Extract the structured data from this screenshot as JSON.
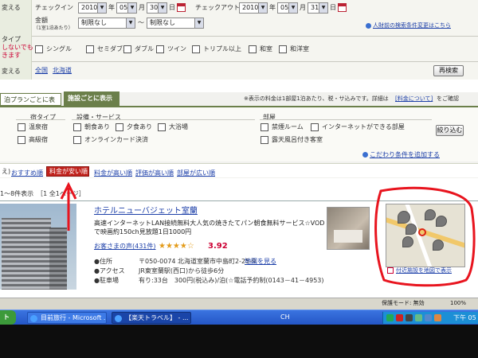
{
  "form": {
    "checkin_label": "チェックイン",
    "checkin": {
      "year": "2010",
      "year_unit": "年",
      "month": "05",
      "month_unit": "月",
      "day": "30",
      "day_unit": "日"
    },
    "checkout_label": "チェックアウト",
    "checkout": {
      "year": "2010",
      "year_unit": "年",
      "month": "05",
      "month_unit": "月",
      "day": "31",
      "day_unit": "日"
    },
    "price_label": "金額",
    "price_sublabel": "（1室1泊あたり）",
    "price_min": "制限なし",
    "tilde": "〜",
    "price_max": "制限なし",
    "left_label_1": "変える",
    "left_label_2": "タイプ",
    "left_label_3": "しないでも",
    "left_label_4": "きます",
    "left_label_5": "変える",
    "room_types": [
      "シングル",
      "セミダブル",
      "ダブル",
      "ツイン",
      "トリプル以上",
      "和室",
      "和洋室"
    ],
    "area_all": "全国",
    "area_region": "北海道",
    "research_button": "再検索",
    "history_link": "人財前の検索条件変更はこちら"
  },
  "tabs": {
    "plan": "泊プランごとに表示",
    "facility": "施設ごとに表示"
  },
  "note": {
    "text": "※表示の料金は1部屋1泊あたり、税・サ込みです。詳細は",
    "link": "[料金について]",
    "tail": "をご確認"
  },
  "filters": {
    "inn_type_title": "宿タイプ",
    "inn_types": [
      "温泉宿",
      "高級宿"
    ],
    "facility_title": "設備・サービス",
    "facilities": [
      "朝食あり",
      "夕食あり",
      "大浴場",
      "オンラインカード決済"
    ],
    "room_title": "部屋",
    "rooms": [
      "禁煙ルーム",
      "インターネットができる部屋",
      "露天風呂付き客室"
    ],
    "narrow_button": "絞り込む",
    "more_link": "こだわり条件を追加する"
  },
  "sort": {
    "prefix": "え)",
    "recommended": "おすすめ順",
    "cheap_first": "料金が安い順",
    "expensive_first": "料金が高い順",
    "rating": "評価が高い順",
    "rooms": "部屋が広い順"
  },
  "result_count": "1〜8件表示　［1 全1ページ］",
  "hotel": {
    "name": "ホテルニューバジェット室蘭",
    "description": "高速インターネットLAN接続無料大人気の焼きたてパン朝食無料サービス☆VOD で映画約150ch見放題1日1000円",
    "reviews_link": "お客さまの声(431件)",
    "stars": "★★★★☆",
    "rating": "3.92",
    "address_label": "●住所",
    "address": "〒050-0074 北海道室蘭市中島町2-25-9",
    "map_link": "地図を見る",
    "access_label": "●アクセス",
    "access": "JR東室蘭駅(西口)から徒歩6分",
    "parking_label": "●駐車場",
    "parking": "有り:33台　300円(税込み)/泊(☆電話予約制(0143－41－4953)",
    "map_caption": "付近施設を地図で表示"
  },
  "status_bar": {
    "protected_mode": "保護モード: 無効",
    "zoom": "100%"
  },
  "taskbar": {
    "start": "ト",
    "items": [
      "目前旅行 - Microsoft ...",
      "【楽天トラベル】 - ..."
    ],
    "ime": "CH",
    "time": "下午 05"
  },
  "annotation_colors": {
    "circle": "#e8141e",
    "arrow": "#e8141e"
  }
}
